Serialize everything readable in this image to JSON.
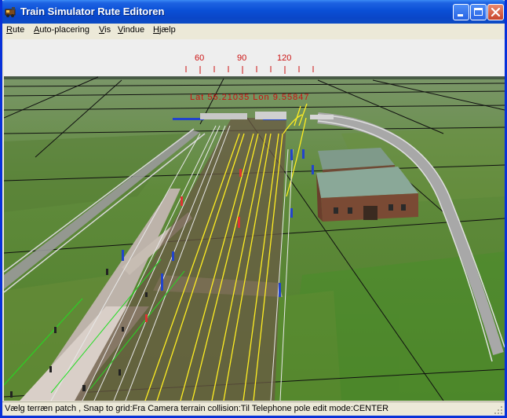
{
  "window": {
    "title": "Train Simulator Rute Editoren"
  },
  "menu": [
    {
      "label": "Rute",
      "accel": "R",
      "rest": "ute"
    },
    {
      "label": "Auto-placering",
      "accel": "A",
      "rest": "uto-placering"
    },
    {
      "label": "Vis",
      "accel": "V",
      "rest": "is"
    },
    {
      "label": "Vindue",
      "accel": "V",
      "rest": "indue"
    },
    {
      "label": "Hjælp",
      "accel": "H",
      "rest": "jælp"
    }
  ],
  "compass": {
    "ticks": [
      "60",
      "90",
      "120"
    ],
    "readout": "Lat 56.21035 Lon 9.55847"
  },
  "status": {
    "text": "Vælg terræn patch , Snap to grid:Fra Camera terrain collision:Til Telephone pole edit mode:CENTER"
  },
  "colors": {
    "titlebar": "#0a46c8",
    "grass": "#5e8a3a",
    "sky": "#eeeeee",
    "compass_red": "#cc1111",
    "rail_yellow": "#ffee22"
  },
  "icons": [
    "app-icon",
    "minimize-icon",
    "maximize-icon",
    "close-icon",
    "resize-grip-icon"
  ]
}
